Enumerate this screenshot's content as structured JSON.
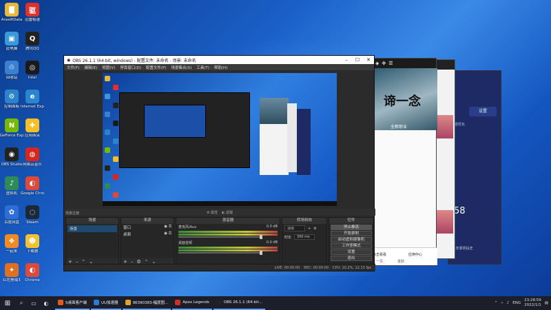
{
  "desktop": {
    "icons": [
      {
        "label": "AnsoftData",
        "glyph": "▇",
        "color": "#e7b83a"
      },
      {
        "label": "迅雷极速",
        "glyph": "驱",
        "color": "#e0302c"
      },
      {
        "label": "此电脑",
        "glyph": "▣",
        "color": "#3a9ad9"
      },
      {
        "label": "腾讯QQ",
        "glyph": "Q",
        "color": "#222"
      },
      {
        "label": "回收站",
        "glyph": "♲",
        "color": "#3b7fd0"
      },
      {
        "label": "Intel",
        "glyph": "◎",
        "color": "#1a1a1a"
      },
      {
        "label": "控制面板",
        "glyph": "⚙",
        "color": "#2d83c9"
      },
      {
        "label": "Internet Explorer",
        "glyph": "e",
        "color": "#2a84d0"
      },
      {
        "label": "GeForce Experience",
        "glyph": "N",
        "color": "#76b900"
      },
      {
        "label": "应用商店",
        "glyph": "✚",
        "color": "#f4c025"
      },
      {
        "label": "OBS Studio",
        "glyph": "◉",
        "color": "#222"
      },
      {
        "label": "网易云音乐",
        "glyph": "◍",
        "color": "#d8261f"
      },
      {
        "label": "虚拟机",
        "glyph": "♪",
        "color": "#2e8b57"
      },
      {
        "label": "Google Chrome",
        "glyph": "◐",
        "color": "#de4a3a"
      },
      {
        "label": "百度网盘",
        "glyph": "✿",
        "color": "#2d6fd6"
      },
      {
        "label": "Steam",
        "glyph": "◌",
        "color": "#1b2838"
      },
      {
        "label": "一起来",
        "glyph": "❖",
        "color": "#f08a24"
      },
      {
        "label": "下载器",
        "glyph": "☻",
        "color": "#f1c232"
      },
      {
        "label": "红色警戒3",
        "glyph": "✦",
        "color": "#e07020"
      },
      {
        "label": "Chrome",
        "glyph": "◐",
        "color": "#de4a3a"
      }
    ]
  },
  "obs": {
    "title": "OBS 26.1.1 (64-bit, windows) - 配置文件: 未命名 - 场景: 未命名",
    "menu": [
      "文件(F)",
      "编辑(E)",
      "视图(V)",
      "停靠窗口(D)",
      "配置文件(P)",
      "场景集合(S)",
      "工具(T)",
      "帮助(H)"
    ],
    "toolbar": {
      "properties": "属性",
      "filters": "滤镜"
    },
    "docks": {
      "scenes": {
        "header": "场景",
        "item": "场景"
      },
      "sources": {
        "header": "来源",
        "items": [
          "窗口",
          "桌面"
        ]
      },
      "mixer": {
        "header": "混音器",
        "channels": [
          {
            "name": "麦克风/Aux",
            "db": "0.0 dB"
          },
          {
            "name": "桌面音频",
            "db": "0.0 dB"
          }
        ]
      },
      "transitions": {
        "header": "转场特效",
        "type": "淡出",
        "duration_label": "时长",
        "duration": "300 ms"
      },
      "controls": {
        "header": "控件",
        "buttons": [
          "停止推流",
          "开始录制",
          "启动虚拟摄像机",
          "工作室模式",
          "设置",
          "退出"
        ]
      }
    },
    "dock_title": "场景过渡",
    "status": {
      "live": "LIVE: 00:00:00",
      "rec": "REC: 00:00:00",
      "cpu": "CPU: 10.2%, 12.13 fps"
    }
  },
  "bg_windows": {
    "win1_title": "谛一念",
    "win1_subtitle": "全新职业",
    "win1_bottom_items": [
      "点击看看",
      "应用中心"
    ],
    "win1_bottom_links": [
      "上一页",
      "发财"
    ],
    "win3_settings": "设置",
    "win3_percent": "58",
    "win3_texts": [
      "内容优化",
      "EX年季师扶史"
    ]
  },
  "taskbar": {
    "items": [
      {
        "label": "S桌面客户端",
        "color": "#e05a1f"
      },
      {
        "label": "UU加速器",
        "color": "#2d7ad9"
      },
      {
        "label": "96390383-幅度图...",
        "color": "#e2a52a"
      },
      {
        "label": "Apex Legends",
        "color": "#c8322c"
      },
      {
        "label": "OBS 26.1.1 (64-bit...",
        "color": "#222"
      }
    ],
    "lang": "ENG",
    "time": "23:28:59",
    "date": "2022/1/1"
  }
}
